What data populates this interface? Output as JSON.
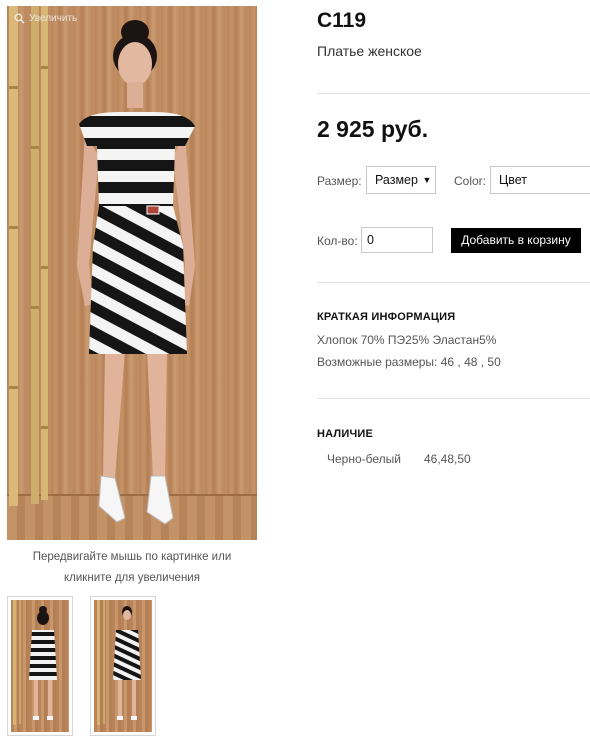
{
  "gallery": {
    "zoom_label": "Увеличить",
    "zoom_icon": "magnifier-icon",
    "caption_line1": "Передвигайте мышь по картинке или",
    "caption_line2": "кликните для увеличения",
    "thumbnails": [
      "back-view",
      "front-view"
    ]
  },
  "product": {
    "sku": "С119",
    "name": "Платье женское",
    "price": "2 925 руб."
  },
  "options": {
    "size_label": "Размер:",
    "size_value": "Размер",
    "color_label": "Color:",
    "color_value": "Цвет",
    "qty_label": "Кол-во:",
    "qty_value": "0",
    "add_to_cart": "Добавить в корзину"
  },
  "summary": {
    "title": "КРАТКАЯ ИНФОРМАЦИЯ",
    "composition": "Хлопок 70% ПЭ25% Эластан5%",
    "sizes": "Возможные размеры: 46 , 48 , 50"
  },
  "availability": {
    "title": "НАЛИЧИЕ",
    "rows": [
      {
        "color": "Черно-белый",
        "sizes": "46,48,50"
      }
    ]
  },
  "colors": {
    "accent": "#000000",
    "wood": "#c08b5f"
  }
}
